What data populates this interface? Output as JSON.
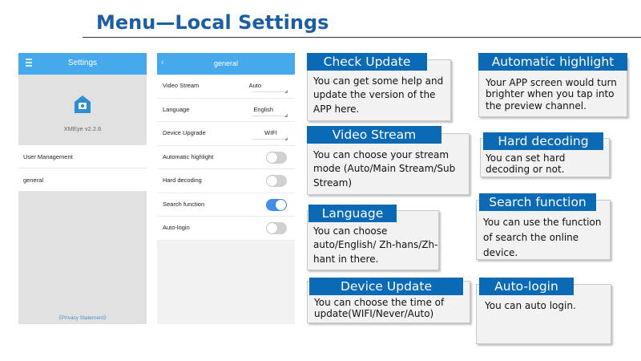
{
  "page_title": "Menu—Local Settings",
  "phone1": {
    "title": "Settings",
    "version": "XMEye v2.2.6",
    "items": [
      "User Management",
      "general"
    ],
    "privacy": "《Privacy Statement》"
  },
  "phone2": {
    "title": "general",
    "rows": [
      {
        "label": "Video Stream",
        "value": "Auto"
      },
      {
        "label": "Language",
        "value": "English"
      },
      {
        "label": "Device Upgrade",
        "value": "WIFI"
      },
      {
        "label": "Automatic highlight",
        "toggle": false
      },
      {
        "label": "Hard decoding",
        "toggle": false
      },
      {
        "label": "Search function",
        "toggle": true
      },
      {
        "label": "Auto-login",
        "toggle": false
      }
    ]
  },
  "boxes": {
    "check_update": {
      "title": "Check Update",
      "text": "You can get some help and update the version of the APP here."
    },
    "video_stream": {
      "title": "Video Stream",
      "text": "You can choose your stream mode (Auto/Main Stream/Sub Stream)"
    },
    "language": {
      "title": "Language",
      "text": "You can choose auto/English/ Zh-hans/Zh-hant in there."
    },
    "device_update": {
      "title": "Device Update",
      "text": "You can choose the time of update(WIFI/Never/Auto)"
    },
    "automatic_highlight": {
      "title": "Automatic highlight",
      "text": "Your APP screen would turn brighter when you tap into the preview channel."
    },
    "hard_decoding": {
      "title": "Hard decoding",
      "text": "You can set hard decoding or not."
    },
    "search_function": {
      "title": "Search function",
      "text": "You can use the function of search the online device."
    },
    "auto_login": {
      "title": "Auto-login",
      "text": "You can  auto login."
    }
  },
  "colors": {
    "header_blue": "#45a9ec",
    "tag_blue": "#0b6ab5",
    "title_blue": "#1a5fa6",
    "toggle_on": "#3f8ee8"
  }
}
